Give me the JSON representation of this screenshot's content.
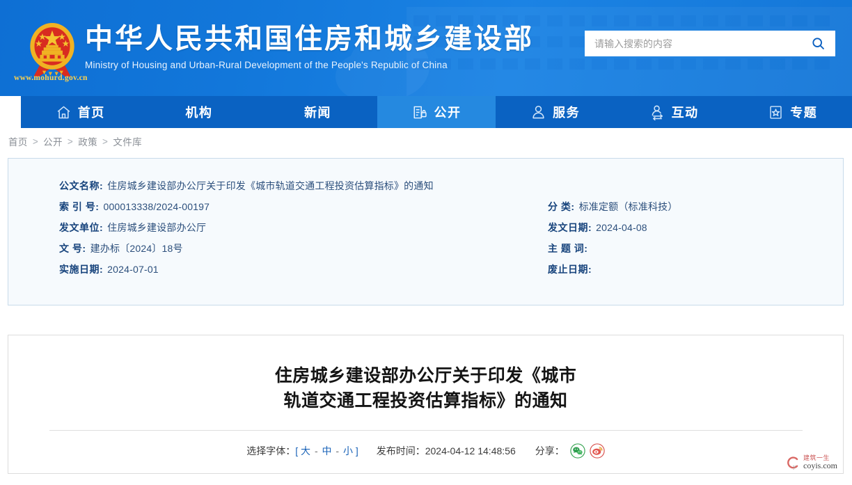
{
  "header": {
    "title_cn": "中华人民共和国住房和城乡建设部",
    "title_en": "Ministry of Housing and Urban-Rural Development of the People's Republic of China",
    "site_url": "www.mohurd.gov.cn",
    "emblem_icon": "national-emblem-icon",
    "search": {
      "placeholder": "请输入搜索的内容",
      "value": "",
      "icon": "search-icon"
    },
    "brand_color": "#1277da",
    "accent_color": "#2589e0"
  },
  "nav": {
    "items": [
      {
        "label": "首页",
        "icon": "home-icon",
        "active": false
      },
      {
        "label": "机构",
        "icon": "",
        "active": false
      },
      {
        "label": "新闻",
        "icon": "",
        "active": false
      },
      {
        "label": "公开",
        "icon": "document-lock-icon",
        "active": true
      },
      {
        "label": "服务",
        "icon": "person-icon",
        "active": false
      },
      {
        "label": "互动",
        "icon": "person-exchange-icon",
        "active": false
      },
      {
        "label": "专题",
        "icon": "star-card-icon",
        "active": false
      }
    ],
    "bar_color": "#0a62c2",
    "active_color": "#2589e0"
  },
  "breadcrumb": {
    "separator": ">",
    "items": [
      "首页",
      "公开",
      "政策",
      "文件库"
    ]
  },
  "meta": {
    "rows": [
      {
        "left": {
          "key": "公文名称:",
          "value": "住房城乡建设部办公厅关于印发《城市轨道交通工程投资估算指标》的通知"
        },
        "right": {
          "key": "",
          "value": ""
        }
      },
      {
        "left": {
          "key": "索 引 号:",
          "value": "000013338/2024-00197"
        },
        "right": {
          "key": "分    类:",
          "value": "标准定额（标准科技）"
        }
      },
      {
        "left": {
          "key": "发文单位:",
          "value": "住房城乡建设部办公厅"
        },
        "right": {
          "key": "发文日期:",
          "value": "2024-04-08"
        }
      },
      {
        "left": {
          "key": "文    号:",
          "value": "建办标〔2024〕18号"
        },
        "right": {
          "key": "主 题 词:",
          "value": ""
        }
      },
      {
        "left": {
          "key": "实施日期:",
          "value": "2024-07-01"
        },
        "right": {
          "key": "废止日期:",
          "value": ""
        }
      }
    ]
  },
  "article": {
    "title_line1": "住房城乡建设部办公厅关于印发《城市",
    "title_line2": "轨道交通工程投资估算指标》的通知",
    "toolbar": {
      "font_label": "选择字体：",
      "bracket_open": "[",
      "bracket_close": "]",
      "font_large": "大",
      "font_medium": "中",
      "font_small": "小",
      "dash": "-",
      "publish_label": "发布时间：",
      "publish_time": "2024-04-12 14:48:56",
      "share_label": "分享：",
      "share_icons": [
        "wechat-icon",
        "weibo-icon"
      ]
    }
  },
  "watermark": {
    "cn": "建筑一生",
    "en": "coyis.com",
    "mark": "Cy"
  }
}
